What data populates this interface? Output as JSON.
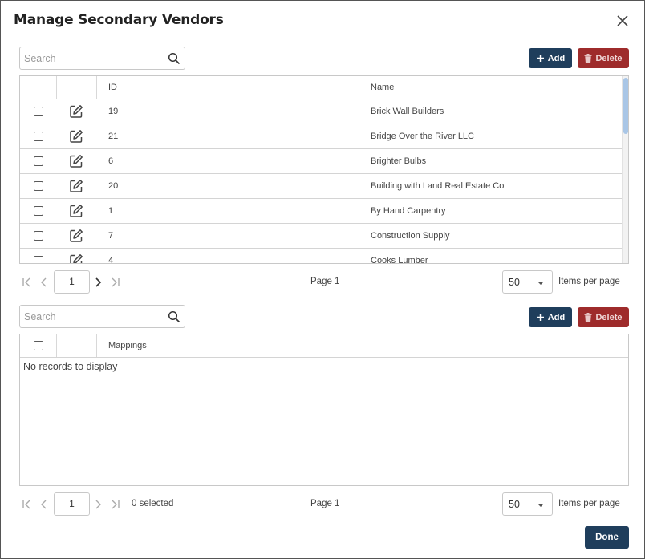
{
  "dialog": {
    "title": "Manage Secondary Vendors",
    "close_icon": "close-icon",
    "done_label": "Done"
  },
  "vendors": {
    "search_placeholder": "Search",
    "add_label": "Add",
    "delete_label": "Delete",
    "columns": [
      "",
      "",
      "ID",
      "Name"
    ],
    "rows": [
      {
        "id": "19",
        "name": "Brick Wall Builders"
      },
      {
        "id": "21",
        "name": "Bridge Over the River LLC"
      },
      {
        "id": "6",
        "name": "Brighter Bulbs"
      },
      {
        "id": "20",
        "name": "Building with Land Real Estate Co"
      },
      {
        "id": "1",
        "name": "By Hand Carpentry"
      },
      {
        "id": "7",
        "name": "Construction Supply"
      },
      {
        "id": "4",
        "name": "Cooks Lumber"
      }
    ],
    "pager": {
      "page_value": "1",
      "page_text": "Page 1",
      "page_size": "50",
      "items_per_page": "Items per page"
    }
  },
  "mappings": {
    "search_placeholder": "Search",
    "add_label": "Add",
    "delete_label": "Delete",
    "columns": [
      "",
      "",
      "Mappings"
    ],
    "empty_text": "No records to display",
    "pager": {
      "page_value": "1",
      "selected_text": "0 selected",
      "page_text": "Page 1",
      "page_size": "50",
      "items_per_page": "Items per page"
    }
  },
  "colors": {
    "primary": "#1f3e5c",
    "danger": "#9e2b2b",
    "scroll_thumb": "#a9c6e6"
  }
}
